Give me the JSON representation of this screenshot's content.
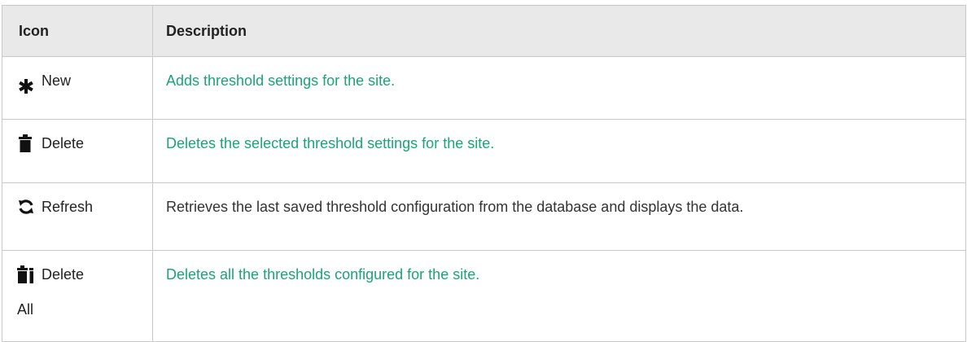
{
  "table": {
    "headers": {
      "icon": "Icon",
      "description": "Description"
    },
    "rows": [
      {
        "icon_name": "asterisk-icon",
        "label": "New",
        "description": "Adds threshold settings for the site.",
        "description_is_link": true
      },
      {
        "icon_name": "trash-icon",
        "label": "Delete",
        "description": "Deletes the selected threshold settings for the site.",
        "description_is_link": true
      },
      {
        "icon_name": "refresh-icon",
        "label": "Refresh",
        "description": "Retrieves the last saved threshold configuration from the database and displays the data.",
        "description_is_link": false
      },
      {
        "icon_name": "delete-all-icon",
        "label": "Delete",
        "label_continued": "All",
        "description": "Deletes all the thresholds configured for the site.",
        "description_is_link": true
      }
    ]
  },
  "colors": {
    "link": "#1aa574",
    "body_text": "#333333",
    "header_bg": "#e9e9e9",
    "border": "#c9c9c9"
  }
}
